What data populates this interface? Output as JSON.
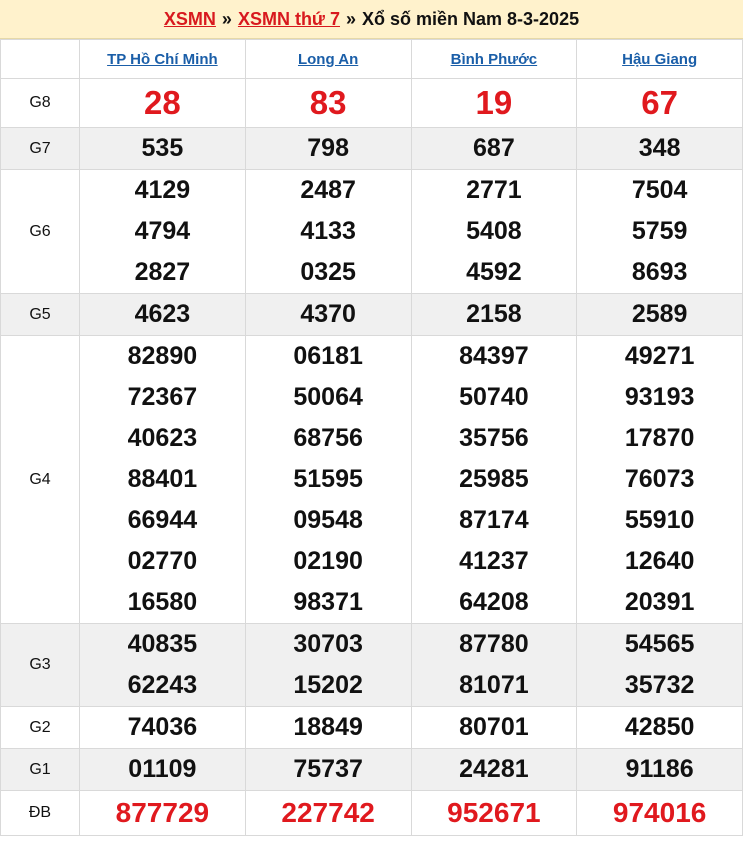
{
  "header": {
    "link1": "XSMN",
    "sep1": "»",
    "link2": "XSMN thứ 7",
    "sep2": "»",
    "title": "Xổ số miền Nam 8-3-2025"
  },
  "provinces": [
    "TP Hồ Chí Minh",
    "Long An",
    "Bình Phước",
    "Hậu Giang"
  ],
  "prizes": [
    {
      "label": "G8",
      "results": [
        [
          "28"
        ],
        [
          "83"
        ],
        [
          "19"
        ],
        [
          "67"
        ]
      ]
    },
    {
      "label": "G7",
      "results": [
        [
          "535"
        ],
        [
          "798"
        ],
        [
          "687"
        ],
        [
          "348"
        ]
      ]
    },
    {
      "label": "G6",
      "results": [
        [
          "4129",
          "4794",
          "2827"
        ],
        [
          "2487",
          "4133",
          "0325"
        ],
        [
          "2771",
          "5408",
          "4592"
        ],
        [
          "7504",
          "5759",
          "8693"
        ]
      ]
    },
    {
      "label": "G5",
      "results": [
        [
          "4623"
        ],
        [
          "4370"
        ],
        [
          "2158"
        ],
        [
          "2589"
        ]
      ]
    },
    {
      "label": "G4",
      "results": [
        [
          "82890",
          "72367",
          "40623",
          "88401",
          "66944",
          "02770",
          "16580"
        ],
        [
          "06181",
          "50064",
          "68756",
          "51595",
          "09548",
          "02190",
          "98371"
        ],
        [
          "84397",
          "50740",
          "35756",
          "25985",
          "87174",
          "41237",
          "64208"
        ],
        [
          "49271",
          "93193",
          "17870",
          "76073",
          "55910",
          "12640",
          "20391"
        ]
      ]
    },
    {
      "label": "G3",
      "results": [
        [
          "40835",
          "62243"
        ],
        [
          "30703",
          "15202"
        ],
        [
          "87780",
          "81071"
        ],
        [
          "54565",
          "35732"
        ]
      ]
    },
    {
      "label": "G2",
      "results": [
        [
          "74036"
        ],
        [
          "18849"
        ],
        [
          "80701"
        ],
        [
          "42850"
        ]
      ]
    },
    {
      "label": "G1",
      "results": [
        [
          "01109"
        ],
        [
          "75737"
        ],
        [
          "24281"
        ],
        [
          "91186"
        ]
      ]
    },
    {
      "label": "ĐB",
      "results": [
        [
          "877729"
        ],
        [
          "227742"
        ],
        [
          "952671"
        ],
        [
          "974016"
        ]
      ]
    }
  ],
  "colors": {
    "accent_red": "#e0191e",
    "link_blue": "#1a5ea8",
    "header_bg": "#fff2cc",
    "alt_row_bg": "#f0f0f0"
  }
}
